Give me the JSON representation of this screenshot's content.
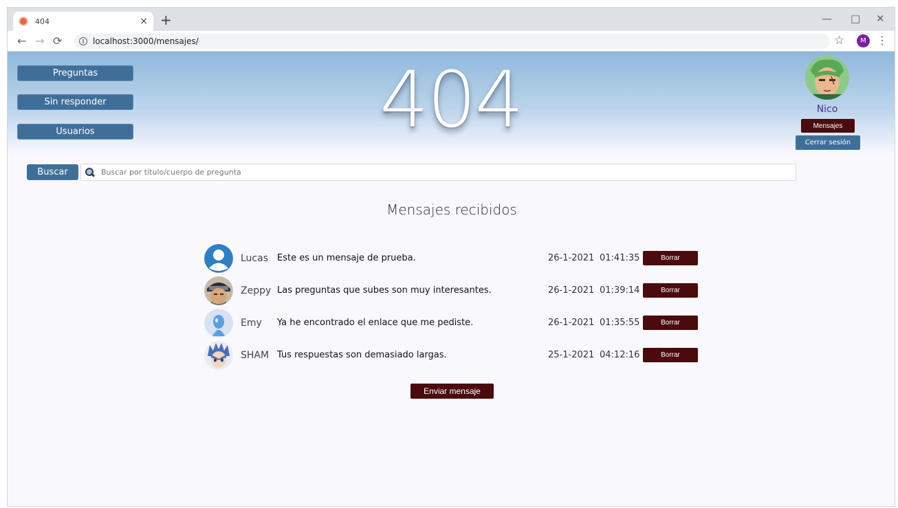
{
  "browser": {
    "tab_title": "404",
    "tab_close": "×",
    "new_tab": "+",
    "url": "localhost:3000/mensajes/",
    "profile_initial": "M",
    "controls": {
      "minimize": "—",
      "maximize": "□",
      "close": "✕"
    }
  },
  "nav": {
    "items": [
      {
        "label": "Preguntas"
      },
      {
        "label": "Sin responder"
      },
      {
        "label": "Usuarios"
      }
    ]
  },
  "logo": {
    "text": "404"
  },
  "user": {
    "name": "Nico",
    "messages_label": "Mensajes",
    "logout_label": "Cerrar sesión"
  },
  "search": {
    "button_label": "Buscar",
    "placeholder": "Buscar por título/cuerpo de pregunta"
  },
  "inbox": {
    "title": "Mensajes recibidos",
    "delete_label": "Borrar",
    "send_label": "Enviar mensaje",
    "messages": [
      {
        "sender": "Lucas",
        "text": "Este es un mensaje de prueba.",
        "date": "26-1-2021",
        "time": "01:41:35",
        "avatar": "default-user-icon"
      },
      {
        "sender": "Zeppy",
        "text": "Las preguntas que subes son muy interesantes.",
        "date": "26-1-2021",
        "time": "01:39:14",
        "avatar": "anime-ninja-avatar"
      },
      {
        "sender": "Emy",
        "text": "Ya he encontrado el enlace que me pediste.",
        "date": "26-1-2021",
        "time": "01:35:55",
        "avatar": "blue-figure-avatar"
      },
      {
        "sender": "SHAM",
        "text": "Tus respuestas son demasiado largas.",
        "date": "25-1-2021",
        "time": "04:12:16",
        "avatar": "anime-blue-hair-avatar"
      }
    ]
  },
  "colors": {
    "primary_blue": "#3f6f99",
    "maroon": "#4a0a0e",
    "user_name": "#4a2c8a"
  }
}
